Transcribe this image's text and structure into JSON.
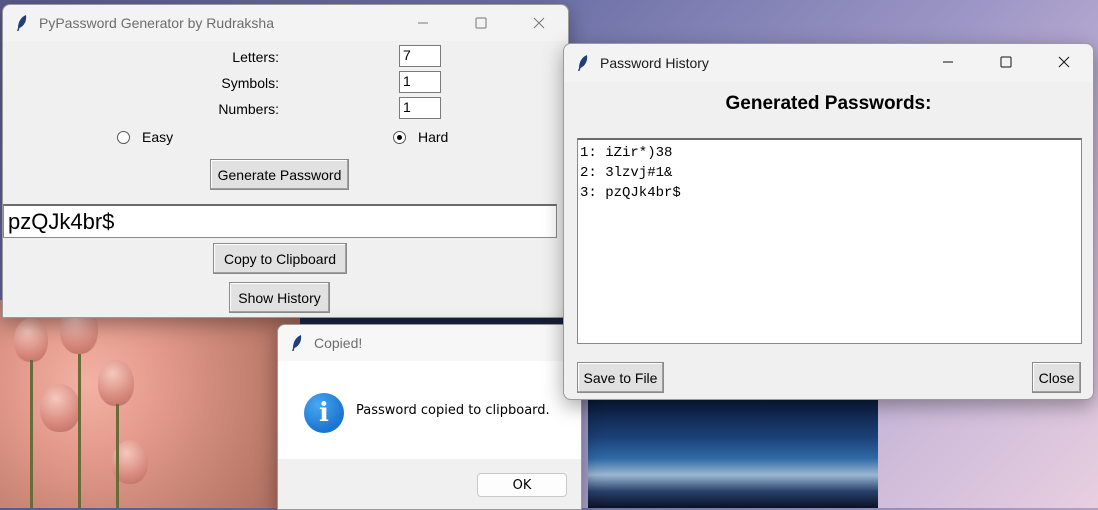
{
  "main_window": {
    "title": "PyPassword Generator by Rudraksha",
    "fields": [
      {
        "label": "Letters:",
        "value": "7"
      },
      {
        "label": "Symbols:",
        "value": "1"
      },
      {
        "label": "Numbers:",
        "value": "1"
      }
    ],
    "difficulty": [
      {
        "label": "Easy",
        "selected": false
      },
      {
        "label": "Hard",
        "selected": true
      }
    ],
    "generate_label": "Generate Password",
    "password": "pzQJk4br$",
    "copy_label": "Copy to Clipboard",
    "history_label": "Show History"
  },
  "copied_dialog": {
    "title": "Copied!",
    "message": "Password copied to clipboard.",
    "ok_label": "OK"
  },
  "history_window": {
    "title": "Password History",
    "heading": "Generated Passwords:",
    "entries": [
      "1: iZir*)38",
      "2: 3lzvj#1&",
      "3: pzQJk4br$"
    ],
    "save_label": "Save to File",
    "close_label": "Close"
  },
  "icons": {
    "app": "feather-icon",
    "info": "info-icon",
    "minimize": "minimize-icon",
    "maximize": "maximize-icon",
    "close": "close-icon"
  }
}
